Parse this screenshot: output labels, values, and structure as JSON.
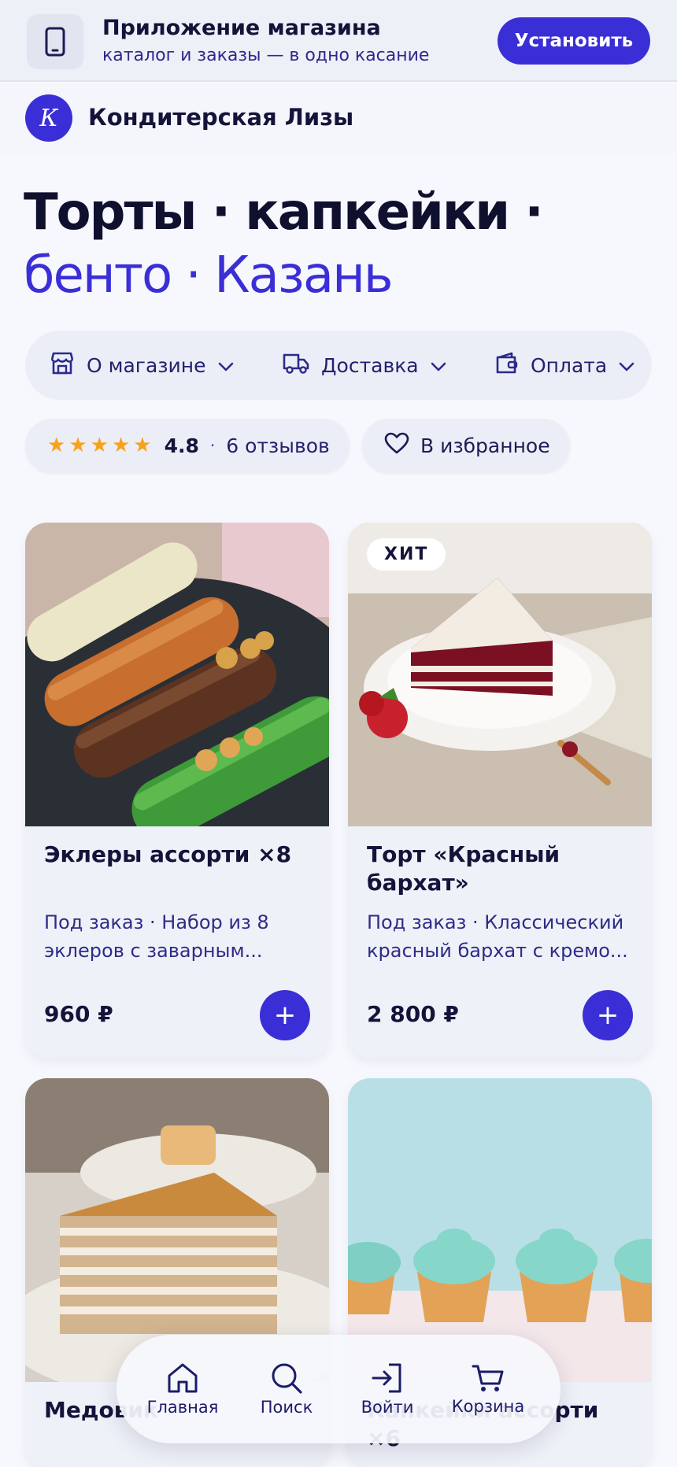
{
  "banner": {
    "title": "Приложение магазина",
    "subtitle": "каталог и заказы — в одно касание",
    "install_label": "Установить"
  },
  "store": {
    "avatar_letter": "К",
    "name": "Кондитерская Лизы"
  },
  "hero": {
    "line1": "Торты · капкейки ·",
    "line2": "бенто · Казань"
  },
  "info_bar": [
    {
      "label": "О магазине",
      "icon": "store-icon"
    },
    {
      "label": "Доставка",
      "icon": "truck-icon"
    },
    {
      "label": "Оплата",
      "icon": "wallet-icon"
    }
  ],
  "rating": {
    "stars": 5,
    "value": "4.8",
    "separator": "·",
    "reviews": "6 отзывов"
  },
  "favorite": {
    "label": "В избранное",
    "icon": "heart-icon"
  },
  "products": [
    {
      "title": "Эклеры ассорти ×8",
      "description": "Под заказ · Набор из 8 эклеров с заварным...",
      "price": "960 ₽",
      "badge": "",
      "image": "eclairs-photo"
    },
    {
      "title": "Торт «Красный бархат»",
      "description": "Под заказ · Классический красный бархат с кремо...",
      "price": "2 800 ₽",
      "badge": "ХИТ",
      "image": "red-velvet-photo"
    },
    {
      "title": "Медовик",
      "description": "",
      "price": "",
      "badge": "",
      "image": "honey-cake-photo"
    },
    {
      "title": "Капкейки ассорти ×6",
      "description": "",
      "price": "",
      "badge": "",
      "image": "cupcakes-photo"
    }
  ],
  "bottom_nav": [
    {
      "label": "Главная",
      "icon": "home-icon",
      "active": true
    },
    {
      "label": "Поиск",
      "icon": "search-icon",
      "active": false
    },
    {
      "label": "Войти",
      "icon": "login-icon",
      "active": false
    },
    {
      "label": "Корзина",
      "icon": "cart-icon",
      "active": false
    }
  ],
  "colors": {
    "accent": "#3a2fd6",
    "text": "#14143a",
    "star": "#f7a21a",
    "background": "#f7f8fd"
  }
}
